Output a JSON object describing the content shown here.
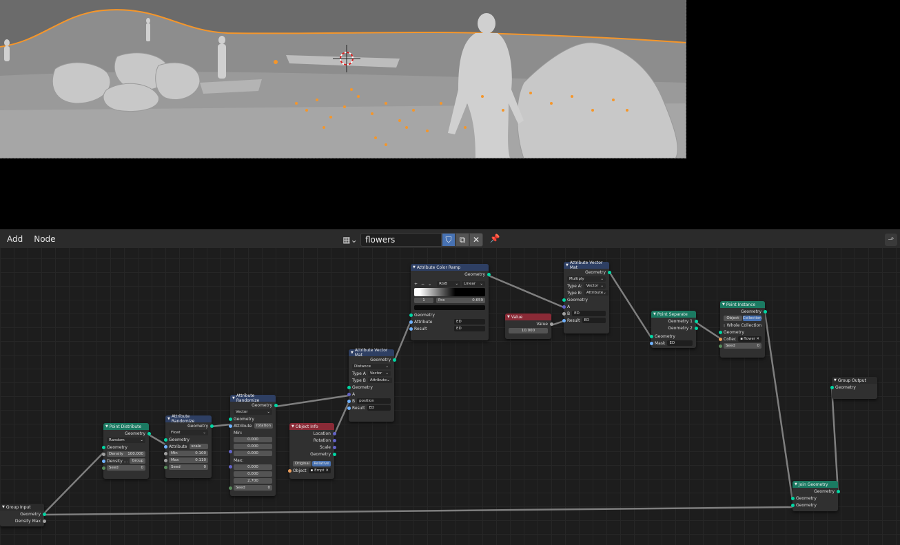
{
  "header": {
    "menus": [
      "Add",
      "Node"
    ],
    "tree_name": "flowers"
  },
  "nodes": {
    "group_input": {
      "title": "Group Input",
      "outputs": [
        "Geometry",
        "Density Max"
      ]
    },
    "point_distribute": {
      "title": "Point Distribute",
      "out": "Geometry",
      "mode": "Random",
      "in_geometry": "Geometry",
      "density_label": "Density",
      "density_value": "100.000",
      "density_attr_label": "Density ...",
      "density_attr_value": "Group",
      "seed_label": "Seed",
      "seed_value": "0"
    },
    "attr_randomize_1": {
      "title": "Attribute Randomize",
      "out": "Geometry",
      "type": "Float",
      "in_geometry": "Geometry",
      "attribute_label": "Attribute",
      "attribute_value": "scale",
      "min_label": "Min",
      "min_value": "0.100",
      "max_label": "Max",
      "max_value": "0.110",
      "seed_label": "Seed",
      "seed_value": "0"
    },
    "attr_randomize_2": {
      "title": "Attribute Randomize",
      "out": "Geometry",
      "type": "Vector",
      "in_geometry": "Geometry",
      "attribute_label": "Attribute",
      "attribute_value": "rotation",
      "min_label": "Min:",
      "min_values": [
        "0.000",
        "0.000",
        "0.000"
      ],
      "max_label": "Max:",
      "max_values": [
        "0.000",
        "0.000",
        "2.700"
      ],
      "seed_label": "Seed",
      "seed_value": "0"
    },
    "object_info": {
      "title": "Object Info",
      "outputs": [
        "Location",
        "Rotation",
        "Scale",
        "Geometry"
      ],
      "mode_original": "Original",
      "mode_relative": "Relative",
      "object_label": "Object",
      "object_value": "Empt"
    },
    "attr_vector_math_1": {
      "title": "Attribute Vector Mat",
      "out": "Geometry",
      "operation": "Distance",
      "type_a_label": "Type A",
      "type_a_value": "Vector",
      "type_b_label": "Type B",
      "type_b_value": "Attribute",
      "in_geometry": "Geometry",
      "a_label": "A",
      "b_label": "B",
      "b_value": "position",
      "result_label": "Result",
      "result_value": "ED"
    },
    "attr_color_ramp": {
      "title": "Attribute Color Ramp",
      "out": "Geometry",
      "ramp_plus": "+",
      "ramp_minus": "−",
      "ramp_dd": "⌄",
      "color_mode": "RGB",
      "interp": "Linear",
      "stop_index": "1",
      "pos_label": "Pos",
      "pos_value": "0.659",
      "in_geometry": "Geometry",
      "attribute_label": "Attribute",
      "attribute_value": "ED",
      "result_label": "Result",
      "result_value": "ED"
    },
    "value": {
      "title": "Value",
      "out": "Value",
      "value": "10.000"
    },
    "attr_vector_math_2": {
      "title": "Attribute Vector Mat",
      "out": "Geometry",
      "operation": "Multiply",
      "type_a_label": "Type A:",
      "type_a_value": "Vector",
      "type_b_label": "Type B:",
      "type_b_value": "Attribute",
      "in_geometry": "Geometry",
      "a_label": "A",
      "b_label": "B",
      "b_value": "ED",
      "result_label": "Result",
      "result_value": "ED"
    },
    "point_separate": {
      "title": "Point Separate",
      "out1": "Geometry 1",
      "out2": "Geometry 2",
      "in_geometry": "Geometry",
      "mask_label": "Mask",
      "mask_value": "ED"
    },
    "point_instance": {
      "title": "Point Instance",
      "out": "Geometry",
      "mode_object": "Object",
      "mode_collection": "Collection",
      "whole_collection": "Whole Collection",
      "in_geometry": "Geometry",
      "collection_label": "Collec",
      "collection_value": "flower",
      "seed_label": "Seed",
      "seed_value": "0"
    },
    "group_output": {
      "title": "Group Output",
      "in": "Geometry"
    },
    "join_geometry": {
      "title": "Join Geometry",
      "out": "Geometry",
      "inputs": [
        "Geometry",
        "Geometry"
      ]
    }
  },
  "colors": {
    "attribute_header": "#2e3f63",
    "geometry_header": "#1b7a62",
    "input_header": "#8a2a36",
    "geometry_socket": "#00d6a3",
    "wire": "#8a8a8a",
    "selection_outline": "#f5962a"
  }
}
